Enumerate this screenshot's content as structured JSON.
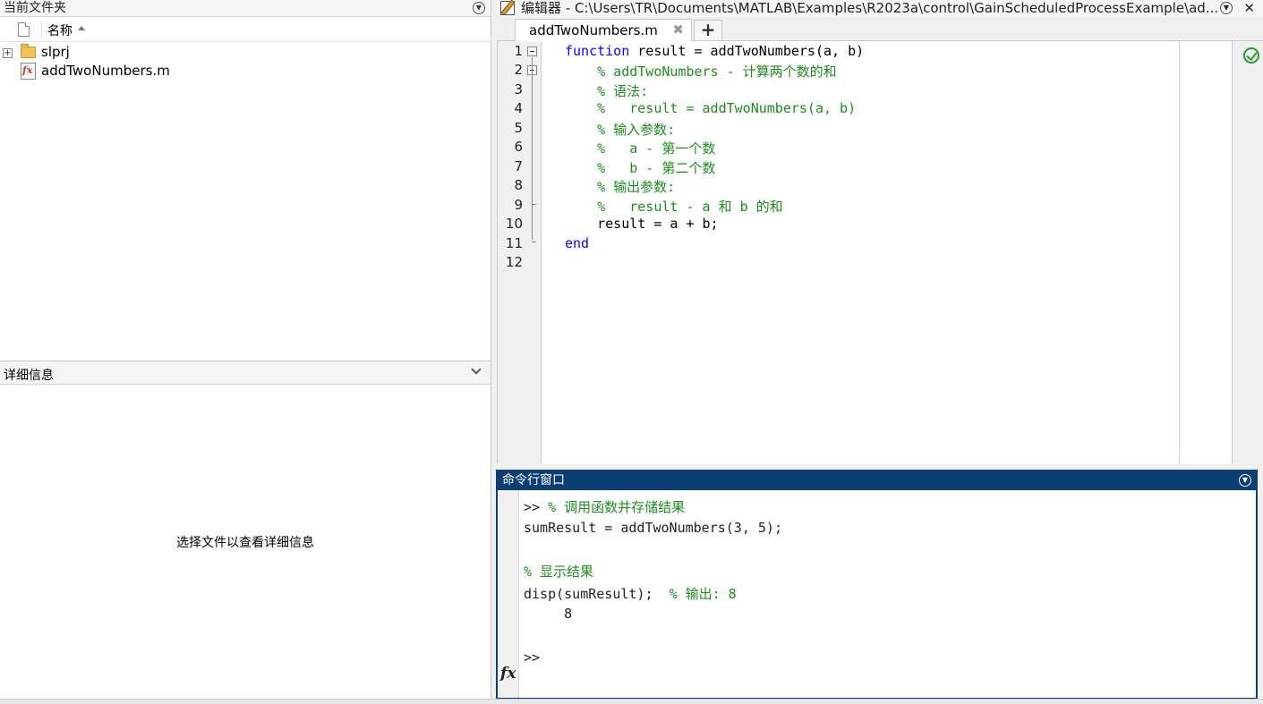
{
  "current_folder": {
    "title": "当前文件夹",
    "column_name": "名称",
    "items": [
      {
        "name": "slprj",
        "type": "folder"
      },
      {
        "name": "addTwoNumbers.m",
        "type": "m-file"
      }
    ]
  },
  "details": {
    "title": "详细信息",
    "empty_message": "选择文件以查看详细信息"
  },
  "editor": {
    "title": "编辑器 - C:\\Users\\TR\\Documents\\MATLAB\\Examples\\R2023a\\control\\GainScheduledProcessExample\\ad...",
    "tab_label": "addTwoNumbers.m",
    "line_numbers": [
      "1",
      "2",
      "3",
      "4",
      "5",
      "6",
      "7",
      "8",
      "9",
      "10",
      "11",
      "12"
    ],
    "code_lines": [
      {
        "kw": "function",
        "text": " result = addTwoNumbers(a, b)",
        "comment": ""
      },
      {
        "kw": "",
        "text": "    ",
        "comment": "% addTwoNumbers - 计算两个数的和"
      },
      {
        "kw": "",
        "text": "    ",
        "comment": "% 语法:"
      },
      {
        "kw": "",
        "text": "    ",
        "comment": "%   result = addTwoNumbers(a, b)"
      },
      {
        "kw": "",
        "text": "    ",
        "comment": "% 输入参数:"
      },
      {
        "kw": "",
        "text": "    ",
        "comment": "%   a - 第一个数"
      },
      {
        "kw": "",
        "text": "    ",
        "comment": "%   b - 第二个数"
      },
      {
        "kw": "",
        "text": "    ",
        "comment": "% 输出参数:"
      },
      {
        "kw": "",
        "text": "    ",
        "comment": "%   result - a 和 b 的和"
      },
      {
        "kw": "",
        "text": "    result = a + b;",
        "comment": ""
      },
      {
        "kw": "end",
        "text": "",
        "comment": ""
      },
      {
        "kw": "",
        "text": "",
        "comment": ""
      }
    ],
    "status": "no-issues"
  },
  "command_window": {
    "title": "命令行窗口",
    "lines": [
      {
        "code": ">> ",
        "comment": "% 调用函数并存储结果"
      },
      {
        "code": "sumResult = addTwoNumbers(3, 5);",
        "comment": ""
      },
      {
        "code": "",
        "comment": ""
      },
      {
        "code": "",
        "comment": "% 显示结果"
      },
      {
        "code": "disp(sumResult);  ",
        "comment": "% 输出: 8"
      },
      {
        "code": "     8",
        "comment": ""
      }
    ],
    "prompt": ">>",
    "fx_label": "fx"
  },
  "colors": {
    "keyword": "#0e00ff",
    "comment": "#228b22",
    "cmd_title_bg": "#0b3f73"
  }
}
